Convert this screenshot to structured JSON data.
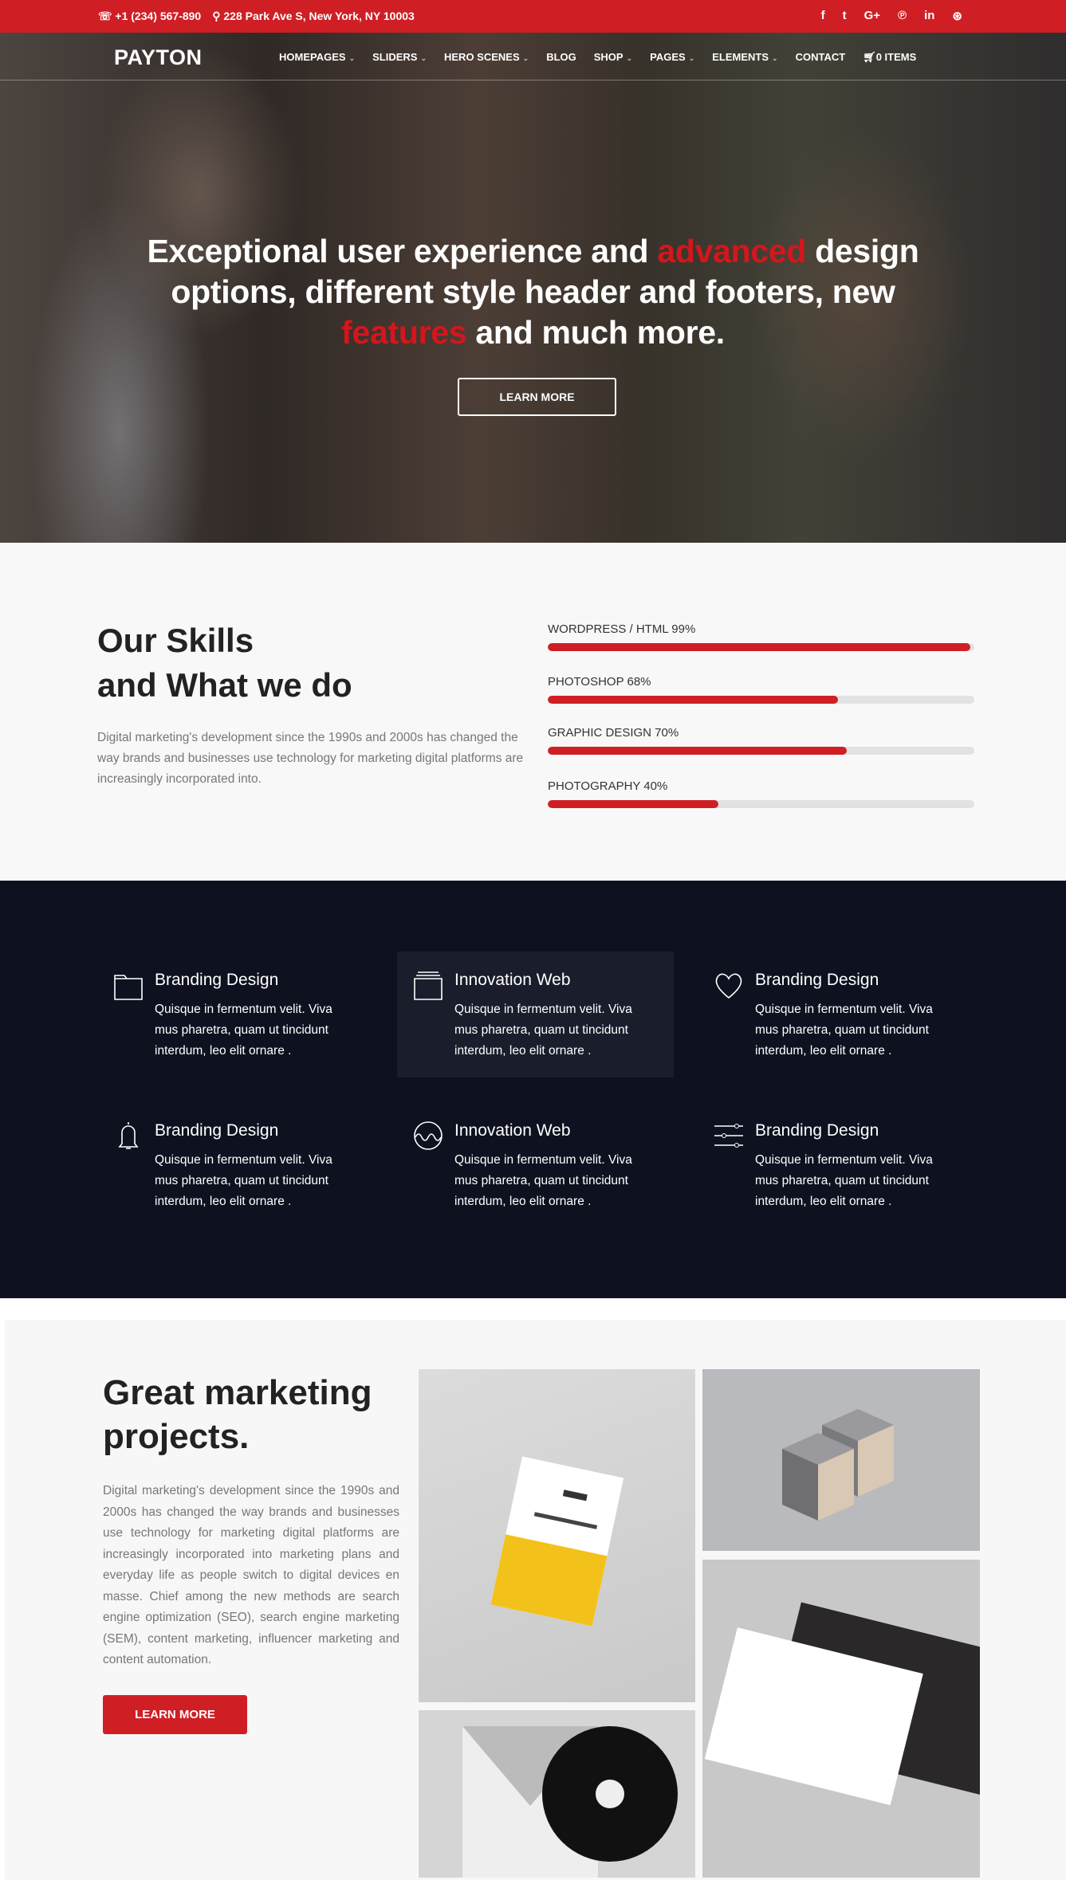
{
  "topbar": {
    "phone": "+1 (234) 567-890",
    "address": "228 Park Ave S, New York, NY 10003",
    "social": [
      {
        "icon": "facebook-icon",
        "glyph": "f"
      },
      {
        "icon": "twitter-icon",
        "glyph": "t"
      },
      {
        "icon": "google-plus-icon",
        "glyph": "G+"
      },
      {
        "icon": "pinterest-icon",
        "glyph": "℗"
      },
      {
        "icon": "linkedin-icon",
        "glyph": "in"
      },
      {
        "icon": "dribbble-icon",
        "glyph": "⊛"
      }
    ]
  },
  "nav": {
    "logo": "PAYTON",
    "items": [
      {
        "label": "HOMEPAGES",
        "dropdown": true
      },
      {
        "label": "SLIDERS",
        "dropdown": true
      },
      {
        "label": "HERO SCENES",
        "dropdown": true
      },
      {
        "label": "BLOG",
        "dropdown": false
      },
      {
        "label": "SHOP",
        "dropdown": true
      },
      {
        "label": "PAGES",
        "dropdown": true
      },
      {
        "label": "ELEMENTS",
        "dropdown": true
      },
      {
        "label": "CONTACT",
        "dropdown": false
      }
    ],
    "cart": "0 ITEMS"
  },
  "hero": {
    "line1": {
      "a": "Exceptional user experience and ",
      "b": "advanced",
      "c": " design"
    },
    "line2": "options, different style header and footers, new",
    "line3": {
      "a": "features",
      "b": " and much more."
    },
    "button": "LEARN MORE"
  },
  "skills": {
    "title1": "Our Skills",
    "title2": "and What we do",
    "text": "Digital marketing's development since the 1990s and 2000s has changed the way brands and businesses use technology for marketing digital platforms are increasingly incorporated into.",
    "bars": [
      {
        "label": "WORDPRESS / HTML  99%",
        "value": 99
      },
      {
        "label": "PHOTOSHOP 68%",
        "value": 68
      },
      {
        "label": "GRAPHIC DESIGN  70%",
        "value": 70
      },
      {
        "label": "PHOTOGRAPHY 40%",
        "value": 40
      }
    ]
  },
  "services": [
    {
      "title": "Branding Design",
      "text": "Quisque in fermentum velit. Viva mus pharetra, quam ut tincidunt interdum, leo elit ornare .",
      "icon": "folder-icon"
    },
    {
      "title": "Innovation Web",
      "text": "Quisque in fermentum velit. Viva mus pharetra, quam ut tincidunt interdum, leo elit ornare .",
      "icon": "layers-icon",
      "highlighted": true
    },
    {
      "title": "Branding Design",
      "text": "Quisque in fermentum velit. Viva mus pharetra, quam ut tincidunt interdum, leo elit ornare .",
      "icon": "heart-icon"
    },
    {
      "title": "Branding Design",
      "text": "Quisque in fermentum velit. Viva mus pharetra, quam ut tincidunt interdum, leo elit ornare .",
      "icon": "bell-icon"
    },
    {
      "title": "Innovation Web",
      "text": "Quisque in fermentum velit. Viva mus pharetra, quam ut tincidunt interdum, leo elit ornare .",
      "icon": "wave-circle-icon"
    },
    {
      "title": "Branding Design",
      "text": "Quisque in fermentum velit. Viva mus pharetra, quam ut tincidunt interdum, leo elit ornare .",
      "icon": "sliders-icon"
    }
  ],
  "projects": {
    "title1": "Great marketing",
    "title2": "projects.",
    "text": "Digital marketing's development since the 1990s and 2000s has changed the way brands and businesses use technology for marketing digital platforms are increasingly incorporated into marketing plans and everyday life as people switch to digital devices en masse. Chief among the new methods are search engine optimization (SEO), search engine marketing (SEM), content marketing, influencer marketing and content automation.",
    "button": "LEARN MORE"
  },
  "colors": {
    "accent": "#cf1f25",
    "dark": "#0e1120",
    "highlight": "#1a1d2c"
  }
}
